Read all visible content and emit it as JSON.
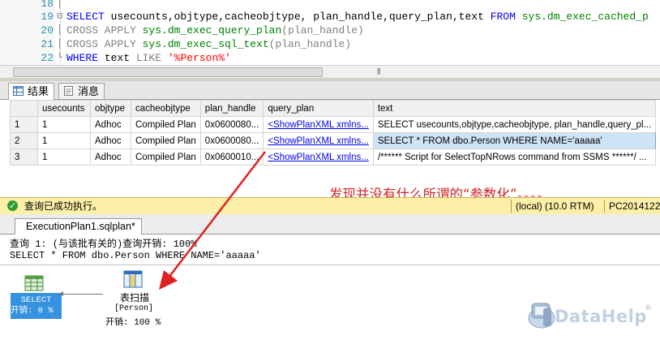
{
  "editor": {
    "lines": [
      {
        "num": "18",
        "marker": "│",
        "code": ""
      },
      {
        "num": "19",
        "marker": "⊟",
        "code": "sel"
      },
      {
        "num": "20",
        "marker": "│",
        "code": "cross1"
      },
      {
        "num": "21",
        "marker": "│",
        "code": "cross2"
      },
      {
        "num": "22",
        "marker": "└",
        "code": "where"
      }
    ],
    "select_kw": "SELECT",
    "select_cols": " usecounts,objtype,cacheobjtype, plan_handle,query_plan,text ",
    "from_kw": "FROM",
    "from_obj": " sys.dm_exec_cached_p",
    "cross_apply_kw": "CROSS APPLY",
    "fn_query_plan": " sys.dm_exec_query_plan",
    "fn_sql_text": " sys.dm_exec_sql_text",
    "arg_plan_handle": "(plan_handle)",
    "where_kw": "WHERE",
    "where_col": " text ",
    "like_kw": "LIKE",
    "like_val": " '%Person%'",
    "scroll_grip": "|||"
  },
  "result_tabs": [
    {
      "label": "结果",
      "icon": "grid-icon",
      "active": true
    },
    {
      "label": "消息",
      "icon": "messages-icon",
      "active": false
    }
  ],
  "grid": {
    "columns": [
      "",
      "usecounts",
      "objtype",
      "cacheobjtype",
      "plan_handle",
      "query_plan",
      "text"
    ],
    "rows": [
      {
        "rn": "1",
        "usecounts": "1",
        "objtype": "Adhoc",
        "cacheobjtype": "Compiled Plan",
        "plan_handle": "0x0600080...",
        "query_plan": "<ShowPlanXML xmlns...",
        "text": "SELECT usecounts,objtype,cacheobjtype, plan_handle,query_pl..."
      },
      {
        "rn": "2",
        "usecounts": "1",
        "objtype": "Adhoc",
        "cacheobjtype": "Compiled Plan",
        "plan_handle": "0x0600080...",
        "query_plan": "<ShowPlanXML xmlns...",
        "text": "SELECT * FROM dbo.Person WHERE NAME='aaaaa'"
      },
      {
        "rn": "3",
        "usecounts": "1",
        "objtype": "Adhoc",
        "cacheobjtype": "Compiled Plan",
        "plan_handle": "0x0600010...",
        "query_plan": "<ShowPlanXML xmlns...",
        "text": "/****** Script for SelectTopNRows command from SSMS  ******/ ..."
      }
    ]
  },
  "annotation": "发现并没有什么所谓的“参数化”。。。。",
  "status": {
    "message": "查询已成功执行。",
    "server": "(local) (10.0 RTM)",
    "host": "PC2014122"
  },
  "plan": {
    "tab": "ExecutionPlan1.sqlplan*",
    "query_header": "查询 1: (与该批有关的)查询开销: 100%",
    "query_text": "SELECT * FROM dbo.Person WHERE NAME='aaaaa'",
    "select_node": {
      "title": "SELECT",
      "cost": "开销: 0 %"
    },
    "scan_node": {
      "title": "表扫描",
      "object": "[Person]",
      "cost": "开销: 100 %"
    }
  },
  "watermark": {
    "text": "DataHelp",
    "mark": "®"
  },
  "colors": {
    "annotation": "#d22323",
    "status_bg": "#fcefa8",
    "selected_node": "#3592e0",
    "keyword": "#0000ff",
    "system": "#008000",
    "function": "#ff00ff"
  }
}
